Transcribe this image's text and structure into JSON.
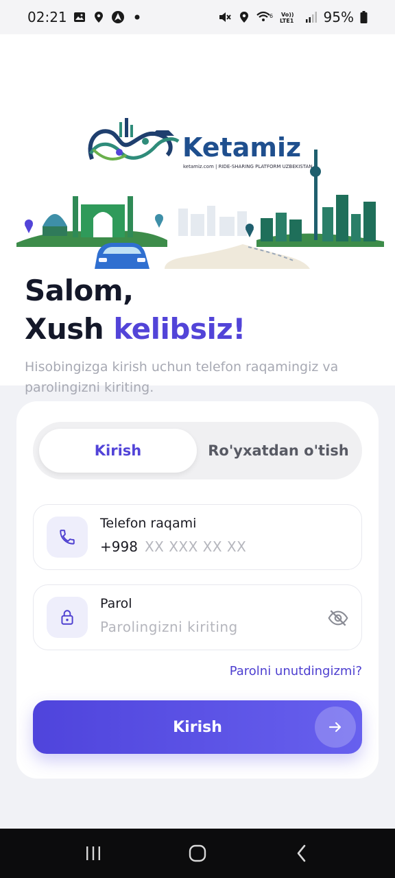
{
  "status_bar": {
    "time": "02:21",
    "battery": "95%",
    "icons_left": [
      "gallery-icon",
      "location-icon",
      "app-icon",
      "dot-icon"
    ],
    "icons_right": [
      "mute-icon",
      "location-icon",
      "wifi-icon",
      "volte-icon",
      "signal-icon",
      "battery-icon"
    ],
    "volte_label": "Vo)) LTE1",
    "wifi_badge": "6"
  },
  "hero": {
    "logo_text": "Ketamiz",
    "logo_tagline": "ketamiz.com | RIDE-SHARING PLATFORM UZBEKISTAN"
  },
  "greeting": {
    "line1": "Salom,",
    "line2_prefix": "Xush ",
    "line2_accent": "kelibsiz!"
  },
  "subtitle": "Hisobingizga kirish uchun telefon raqamingiz va parolingizni kiriting.",
  "tabs": [
    {
      "label": "Kirish",
      "active": true
    },
    {
      "label": "Ro'yxatdan o'tish",
      "active": false
    }
  ],
  "phone_field": {
    "label": "Telefon raqami",
    "prefix": "+998",
    "placeholder": "XX XXX XX XX",
    "icon": "phone-icon"
  },
  "password_field": {
    "label": "Parol",
    "placeholder": "Parolingizni kiriting",
    "icon": "lock-icon",
    "toggle_icon": "eye-off-icon"
  },
  "forgot_link": "Parolni unutdingizmi?",
  "submit": {
    "label": "Kirish",
    "icon": "arrow-right-icon"
  },
  "colors": {
    "accent": "#5244d8",
    "background": "#f1f2f6",
    "card": "#ffffff"
  },
  "nav_bar": {
    "buttons": [
      "recents-icon",
      "home-icon",
      "back-icon"
    ]
  }
}
